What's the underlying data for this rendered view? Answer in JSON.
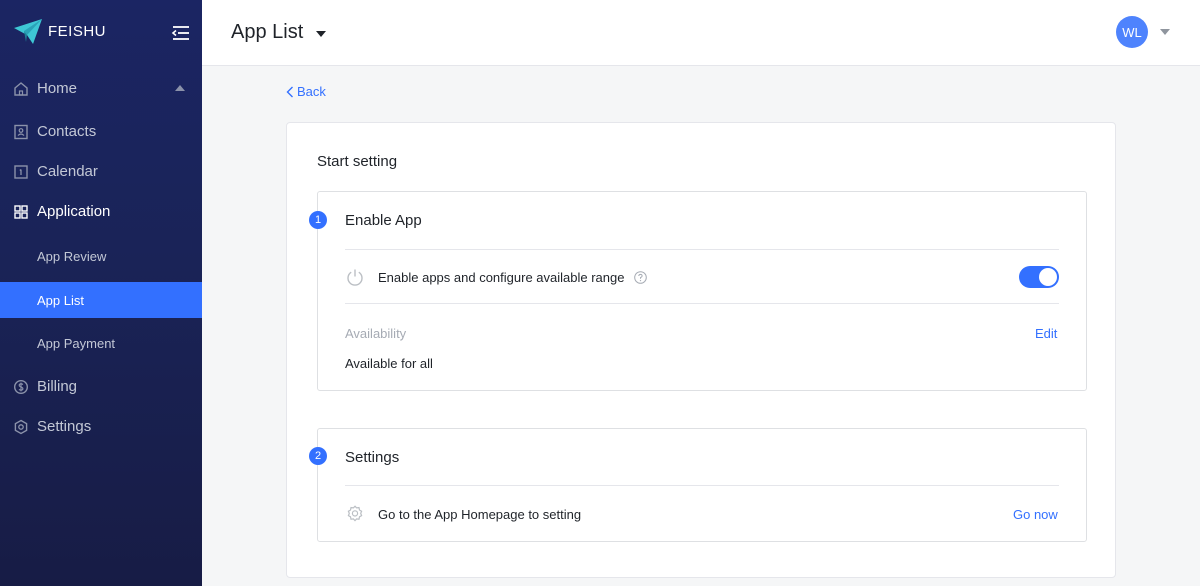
{
  "brand": {
    "name": "FEISHU",
    "accent": "#3370ff"
  },
  "sidebar": {
    "items": [
      {
        "label": "Home",
        "icon": "home-icon"
      },
      {
        "label": "Contacts",
        "icon": "contacts-icon"
      },
      {
        "label": "Calendar",
        "icon": "calendar-icon"
      },
      {
        "label": "Application",
        "icon": "grid-icon"
      },
      {
        "label": "Billing",
        "icon": "dollar-icon"
      },
      {
        "label": "Settings",
        "icon": "hexagon-gear-icon"
      }
    ],
    "sub_items": [
      {
        "label": "App Review"
      },
      {
        "label": "App List",
        "active": true
      },
      {
        "label": "App Payment"
      }
    ]
  },
  "header": {
    "title": "App List",
    "avatar_initials": "WL"
  },
  "content": {
    "back_label": "Back",
    "panel_title": "Start setting",
    "step1": {
      "number": "1",
      "title": "Enable App",
      "toggle_label": "Enable apps and configure available range",
      "toggle_on": true,
      "availability_label": "Availability",
      "edit_label": "Edit",
      "availability_value": "Available for all"
    },
    "step2": {
      "number": "2",
      "title": "Settings",
      "row_text": "Go to the App Homepage to setting",
      "go_label": "Go now"
    }
  }
}
